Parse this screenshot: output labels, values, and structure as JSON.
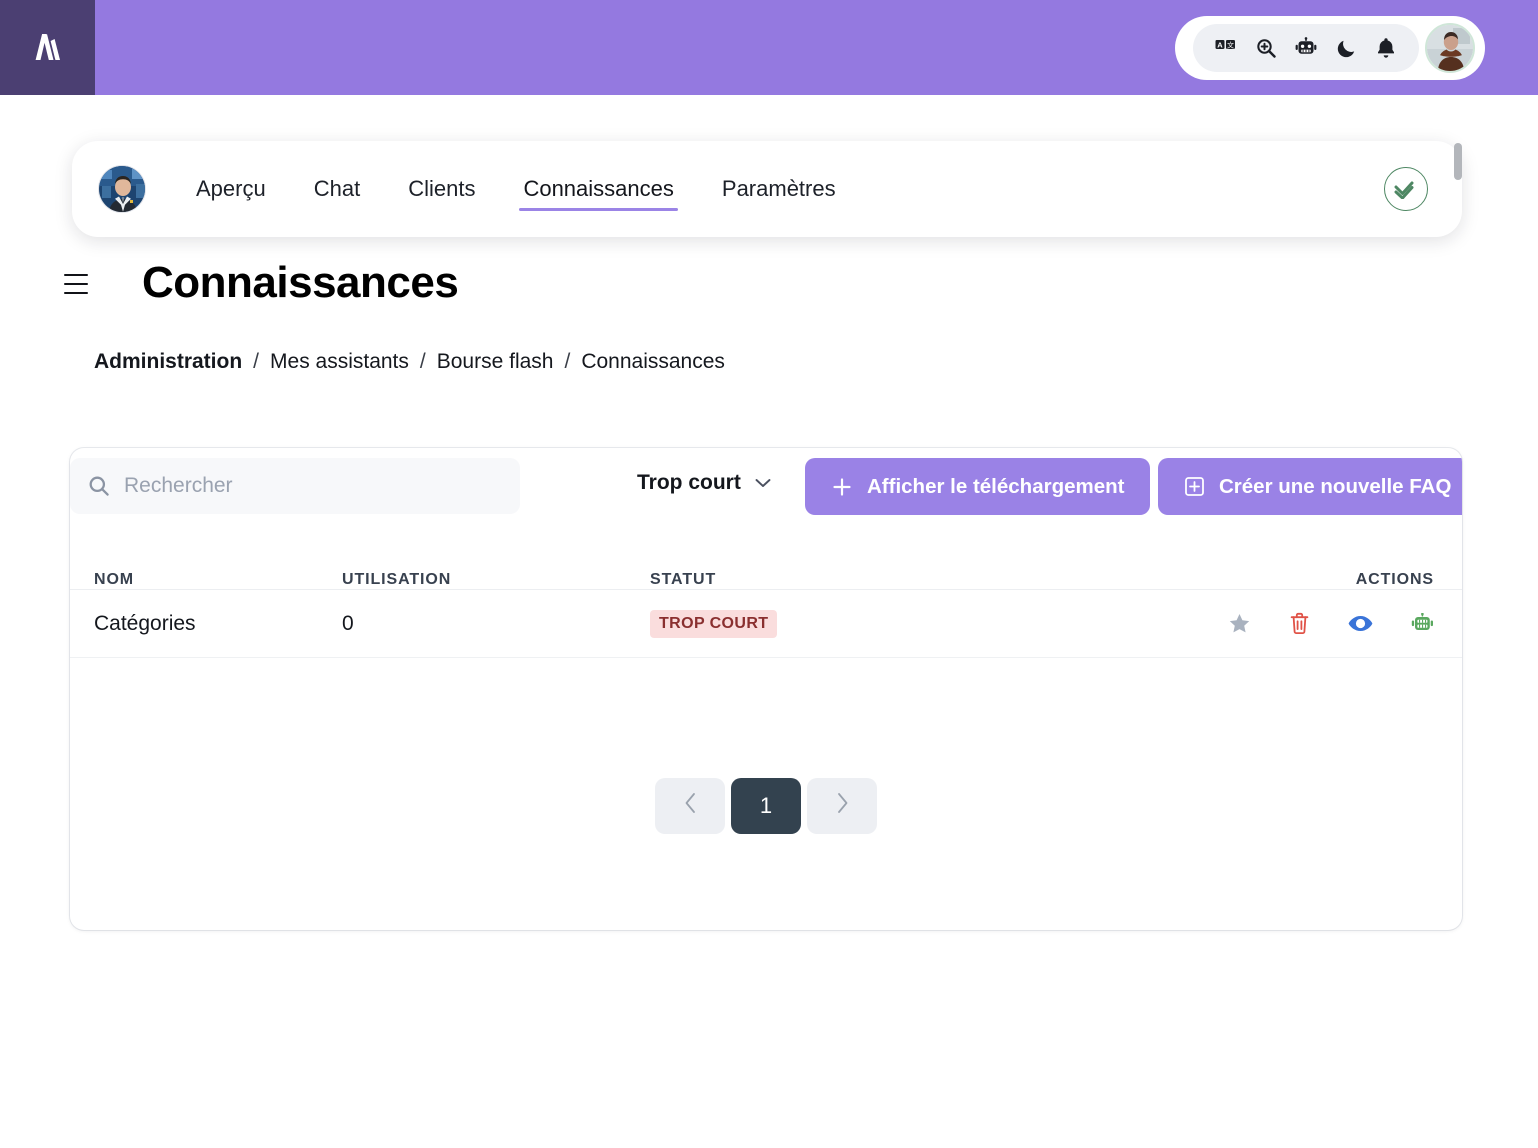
{
  "topbar": {
    "logo_name": "app-logo",
    "icons": [
      {
        "name": "translate-icon",
        "label": "Traduire"
      },
      {
        "name": "zoom-in-icon",
        "label": "Zoom"
      },
      {
        "name": "robot-icon",
        "label": "Assistant"
      },
      {
        "name": "moon-icon",
        "label": "Mode sombre"
      },
      {
        "name": "bell-icon",
        "label": "Notifications"
      }
    ],
    "avatar_label": "Profil utilisateur"
  },
  "nav": {
    "avatar_label": "Assistant Bourse flash",
    "tabs": [
      {
        "label": "Aperçu",
        "active": false
      },
      {
        "label": "Chat",
        "active": false
      },
      {
        "label": "Clients",
        "active": false
      },
      {
        "label": "Connaissances",
        "active": true
      },
      {
        "label": "Paramètres",
        "active": false
      }
    ],
    "status_icon": "double-check-icon",
    "status_color": "#4e8763"
  },
  "page": {
    "title": "Connaissances",
    "menu_icon": "hamburger-menu-icon"
  },
  "breadcrumb": {
    "separator": "/",
    "items": [
      {
        "label": "Administration",
        "strong": true
      },
      {
        "label": "Mes assistants",
        "strong": false
      },
      {
        "label": "Bourse flash",
        "strong": false
      },
      {
        "label": "Connaissances",
        "strong": false
      }
    ]
  },
  "toolbar": {
    "search": {
      "placeholder": "Rechercher",
      "value": "",
      "icon": "search-icon"
    },
    "filter": {
      "selected": "Trop court",
      "icon": "chevron-down-icon",
      "options": [
        "Trop court"
      ]
    },
    "upload_button": {
      "label": "Afficher le téléchargement",
      "icon": "plus-icon"
    },
    "faq_button": {
      "label": "Créer une nouvelle FAQ",
      "icon": "plus-square-icon"
    },
    "accent_color": "#9a82e6"
  },
  "table": {
    "columns": [
      "NOM",
      "UTILISATION",
      "STATUT",
      "ACTIONS"
    ],
    "rows": [
      {
        "nom": "Catégories",
        "utilisation": "0",
        "statut": "TROP COURT",
        "statut_bg": "#fadddd",
        "statut_fg": "#8a2f2f",
        "actions": [
          {
            "name": "favorite-star-icon",
            "color": "#a9b2bf"
          },
          {
            "name": "delete-trash-icon",
            "color": "#e05247"
          },
          {
            "name": "view-eye-icon",
            "color": "#3a74d8"
          },
          {
            "name": "robot-icon",
            "color": "#5aa85f"
          }
        ]
      }
    ]
  },
  "pagination": {
    "prev_icon": "chevron-left-icon",
    "next_icon": "chevron-right-icon",
    "pages": [
      {
        "label": "1",
        "active": true
      }
    ]
  },
  "colors": {
    "header_purple": "#9479e0",
    "logo_purple": "#4b3f72",
    "tab_underline": "#9b84e6",
    "pagination_active": "#33424f"
  }
}
